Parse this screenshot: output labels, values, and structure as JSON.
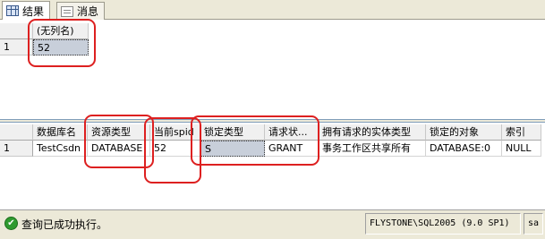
{
  "tabs": [
    {
      "label": "结果",
      "icon": "grid-icon",
      "active": true
    },
    {
      "label": "消息",
      "icon": "message-icon",
      "active": false
    }
  ],
  "result1": {
    "headers": [
      "(无列名)"
    ],
    "rows": [
      {
        "num": "1",
        "cells": [
          "52"
        ]
      }
    ]
  },
  "result2": {
    "headers": [
      "数据库名",
      "资源类型",
      "当前spid",
      "锁定类型",
      "请求状...",
      "拥有请求的实体类型",
      "锁定的对象",
      "索引"
    ],
    "rows": [
      {
        "num": "1",
        "cells": [
          "TestCsdn",
          "DATABASE",
          "52",
          "S",
          "GRANT",
          "事务工作区共享所有",
          "DATABASE:0",
          "NULL"
        ]
      }
    ]
  },
  "status": {
    "message": "查询已成功执行。",
    "server": "FLYSTONE\\SQL2005 (9.0 SP1)",
    "user": "sa"
  },
  "colors": {
    "highlight": "#dd2020",
    "selected_cell": "#c8cfda"
  }
}
